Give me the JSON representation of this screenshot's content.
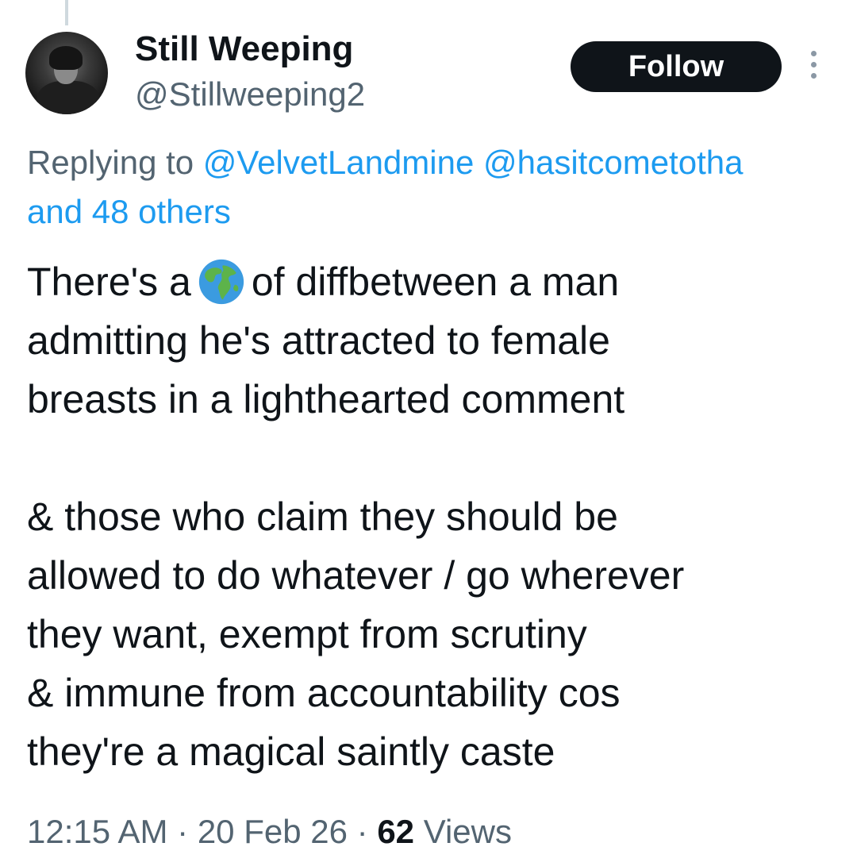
{
  "author": {
    "display_name": "Still Weeping",
    "handle": "@Stillweeping2"
  },
  "actions": {
    "follow_label": "Follow"
  },
  "reply_context": {
    "prefix": "Replying to",
    "mentions": [
      "@VelvetLandmine",
      "@hasitcometotha"
    ],
    "others_text": "and 48 others"
  },
  "tweet": {
    "line_1_before": "There's a",
    "line_1_emoji": "globe-icon",
    "line_1_after": "of diffbetween a man",
    "lines_part_1": [
      "admitting he's attracted to female",
      "breasts in a lighthearted comment"
    ],
    "lines_part_2": [
      "& those who claim they should be",
      "allowed to do whatever / go wherever",
      "they want, exempt from scrutiny",
      "& immune from accountability cos",
      "they're a magical saintly caste"
    ]
  },
  "meta": {
    "time": "12:15 AM",
    "separator": "·",
    "date": "20 Feb 26",
    "views_count": "62",
    "views_label": "Views"
  },
  "colors": {
    "text_primary": "#0f1419",
    "text_secondary": "#536471",
    "link": "#1d9bf0",
    "button_bg": "#0f1419",
    "button_text": "#ffffff"
  }
}
